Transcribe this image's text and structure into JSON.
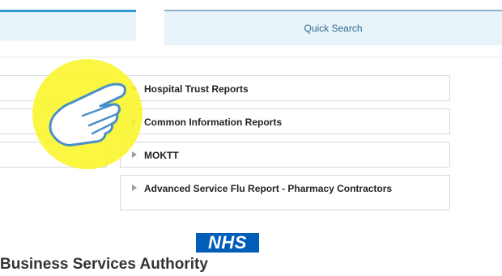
{
  "tabs": [
    {
      "label": ""
    },
    {
      "label": "Quick Search"
    }
  ],
  "reports": [
    {
      "label": "Hospital Trust Reports"
    },
    {
      "label": "Common Information Reports"
    },
    {
      "label": "MOKTT"
    },
    {
      "label": "Advanced Service Flu Report - Pharmacy Contractors"
    }
  ],
  "footer": {
    "logo_text": "NHS",
    "org_name": "Business Services Authority"
  },
  "colors": {
    "tab_background": "#e8f3fa",
    "tab_accent": "#2e9bd6",
    "nhs_blue": "#005eb8",
    "highlight_yellow": "#faf528"
  },
  "icons": {
    "report_arrow": "triangle-right-icon",
    "cursor": "pointing-hand-icon"
  }
}
